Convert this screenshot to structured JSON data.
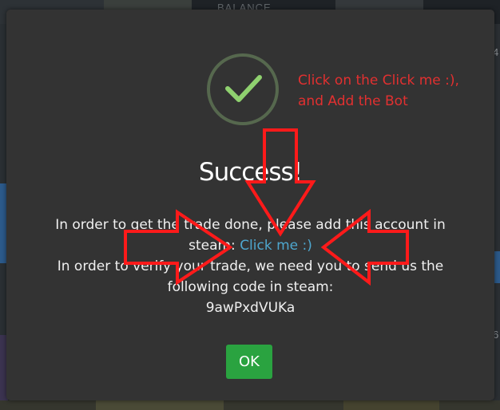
{
  "background": {
    "balance_label": "BALANCE",
    "edge_digit_top": "4",
    "edge_digit_bottom": "6"
  },
  "modal": {
    "icon": "checkmark-icon",
    "title": "Success!",
    "message_line_1": "In order to get the trade done, please add this account in",
    "message_line_2_prefix": "steam: ",
    "link_label": "Click me :)",
    "message_line_3": "In order to verify your trade, we need you to send us the",
    "message_line_4": "following code in steam:",
    "code": "9awPxdVUKa",
    "ok_label": "OK"
  },
  "annotation": {
    "text": "Click on the Click me :), and Add the Bot",
    "arrows": [
      "arrow-down-icon",
      "arrow-right-icon",
      "arrow-left-icon"
    ]
  },
  "colors": {
    "modal_bg": "#333333",
    "check_green": "#8fd16f",
    "circle_border": "#56684e",
    "link": "#4ea7cf",
    "ok_button": "#2aa340",
    "annotation_red": "#e23030"
  }
}
